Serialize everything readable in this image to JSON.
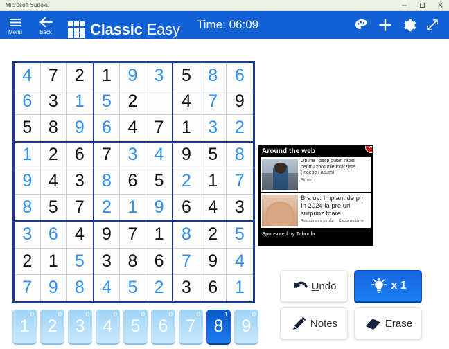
{
  "window": {
    "title": "Microsoft Sudoku",
    "controls": [
      {
        "name": "minimize",
        "glyph": "minimize-icon"
      },
      {
        "name": "maximize",
        "glyph": "maximize-icon"
      },
      {
        "name": "close",
        "glyph": "close-icon"
      }
    ]
  },
  "header": {
    "menu_label": "Menu",
    "back_label": "Back",
    "brand_bold": "Classic",
    "brand_light": "Easy",
    "timer": "Time: 06:09",
    "icons": [
      {
        "name": "theme-palette-icon",
        "label": "Theme"
      },
      {
        "name": "plus-icon",
        "label": "New Game"
      },
      {
        "name": "gear-icon",
        "label": "Settings"
      },
      {
        "name": "expand-icon",
        "label": "Full Screen"
      }
    ],
    "accent_color": "#1160d4"
  },
  "board": {
    "given_color": "#111111",
    "user_color": "#2f90f2",
    "border_color": "#1a3a8f",
    "rows": [
      [
        {
          "v": "4",
          "t": "user"
        },
        {
          "v": "7",
          "t": "given"
        },
        {
          "v": "2",
          "t": "given"
        },
        {
          "v": "1",
          "t": "given"
        },
        {
          "v": "9",
          "t": "user"
        },
        {
          "v": "3",
          "t": "user"
        },
        {
          "v": "5",
          "t": "given"
        },
        {
          "v": "8",
          "t": "user"
        },
        {
          "v": "6",
          "t": "user"
        }
      ],
      [
        {
          "v": "6",
          "t": "user"
        },
        {
          "v": "3",
          "t": "given"
        },
        {
          "v": "1",
          "t": "user"
        },
        {
          "v": "5",
          "t": "user"
        },
        {
          "v": "2",
          "t": "given"
        },
        {
          "v": "",
          "t": "empty"
        },
        {
          "v": "4",
          "t": "given"
        },
        {
          "v": "7",
          "t": "user"
        },
        {
          "v": "9",
          "t": "given"
        }
      ],
      [
        {
          "v": "5",
          "t": "given"
        },
        {
          "v": "8",
          "t": "given"
        },
        {
          "v": "9",
          "t": "user"
        },
        {
          "v": "6",
          "t": "user"
        },
        {
          "v": "4",
          "t": "given"
        },
        {
          "v": "7",
          "t": "given"
        },
        {
          "v": "1",
          "t": "given"
        },
        {
          "v": "3",
          "t": "user"
        },
        {
          "v": "2",
          "t": "user"
        }
      ],
      [
        {
          "v": "1",
          "t": "user"
        },
        {
          "v": "2",
          "t": "given"
        },
        {
          "v": "6",
          "t": "given"
        },
        {
          "v": "7",
          "t": "given"
        },
        {
          "v": "3",
          "t": "user"
        },
        {
          "v": "4",
          "t": "user"
        },
        {
          "v": "9",
          "t": "given"
        },
        {
          "v": "5",
          "t": "given"
        },
        {
          "v": "8",
          "t": "user"
        }
      ],
      [
        {
          "v": "9",
          "t": "user"
        },
        {
          "v": "4",
          "t": "given"
        },
        {
          "v": "3",
          "t": "given"
        },
        {
          "v": "8",
          "t": "user"
        },
        {
          "v": "6",
          "t": "given"
        },
        {
          "v": "5",
          "t": "given"
        },
        {
          "v": "2",
          "t": "user"
        },
        {
          "v": "1",
          "t": "given"
        },
        {
          "v": "7",
          "t": "user"
        }
      ],
      [
        {
          "v": "8",
          "t": "user"
        },
        {
          "v": "5",
          "t": "given"
        },
        {
          "v": "7",
          "t": "given"
        },
        {
          "v": "2",
          "t": "user"
        },
        {
          "v": "1",
          "t": "user"
        },
        {
          "v": "9",
          "t": "user"
        },
        {
          "v": "6",
          "t": "given"
        },
        {
          "v": "4",
          "t": "given"
        },
        {
          "v": "3",
          "t": "given"
        }
      ],
      [
        {
          "v": "3",
          "t": "user"
        },
        {
          "v": "6",
          "t": "user"
        },
        {
          "v": "4",
          "t": "given"
        },
        {
          "v": "9",
          "t": "given"
        },
        {
          "v": "7",
          "t": "given"
        },
        {
          "v": "1",
          "t": "given"
        },
        {
          "v": "8",
          "t": "user"
        },
        {
          "v": "2",
          "t": "given"
        },
        {
          "v": "5",
          "t": "user"
        }
      ],
      [
        {
          "v": "2",
          "t": "given"
        },
        {
          "v": "1",
          "t": "given"
        },
        {
          "v": "5",
          "t": "user"
        },
        {
          "v": "3",
          "t": "given"
        },
        {
          "v": "8",
          "t": "given"
        },
        {
          "v": "6",
          "t": "given"
        },
        {
          "v": "7",
          "t": "user"
        },
        {
          "v": "9",
          "t": "given"
        },
        {
          "v": "4",
          "t": "user"
        }
      ],
      [
        {
          "v": "7",
          "t": "user"
        },
        {
          "v": "9",
          "t": "user"
        },
        {
          "v": "8",
          "t": "user"
        },
        {
          "v": "4",
          "t": "user"
        },
        {
          "v": "5",
          "t": "user"
        },
        {
          "v": "2",
          "t": "user"
        },
        {
          "v": "3",
          "t": "given"
        },
        {
          "v": "6",
          "t": "given"
        },
        {
          "v": "1",
          "t": "user"
        }
      ]
    ]
  },
  "numpad": {
    "keys": [
      {
        "num": "1",
        "count": "0",
        "selected": false
      },
      {
        "num": "2",
        "count": "0",
        "selected": false
      },
      {
        "num": "3",
        "count": "0",
        "selected": false
      },
      {
        "num": "4",
        "count": "0",
        "selected": false
      },
      {
        "num": "5",
        "count": "0",
        "selected": false
      },
      {
        "num": "6",
        "count": "0",
        "selected": false
      },
      {
        "num": "7",
        "count": "0",
        "selected": false
      },
      {
        "num": "8",
        "count": "1",
        "selected": true
      },
      {
        "num": "9",
        "count": "0",
        "selected": false
      }
    ]
  },
  "actions": {
    "undo": {
      "label": "Undo",
      "accel": "U",
      "icon": "undo-arrow-icon"
    },
    "hint": {
      "label": "x 1",
      "icon": "lightbulb-icon"
    },
    "notes": {
      "label": "Notes",
      "accel": "N",
      "icon": "pencil-icon"
    },
    "erase": {
      "label": "Erase",
      "accel": "E",
      "icon": "eraser-icon"
    }
  },
  "ad": {
    "title": "Around the web",
    "close_glyph": "✕",
    "footer": "Sponsored by Taboola",
    "items": [
      {
        "headline": "Ob ine i desp gubiri rapid pentru zborurile intârziate (Începe i acum)",
        "source": "Airhelp",
        "links": []
      },
      {
        "headline": "Bra ov: Implant de p r în 2024 la pre uri surprinz toare",
        "source": "",
        "links": [
          "Restaurarea p rului",
          "Cauta reclame"
        ]
      }
    ]
  }
}
